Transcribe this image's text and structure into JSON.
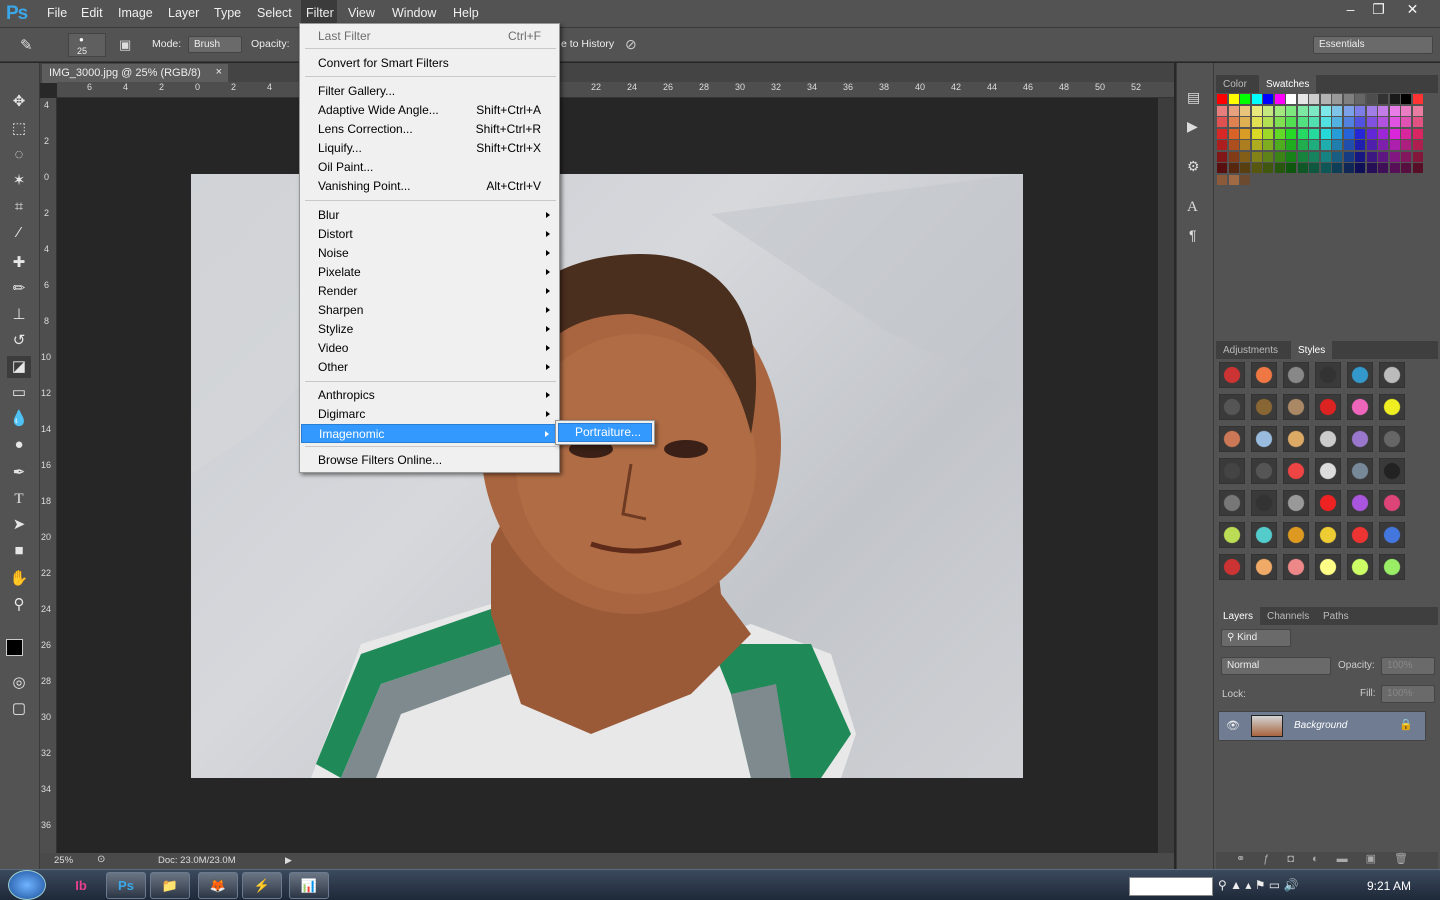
{
  "app": {
    "logo": "Ps",
    "workspace": "Essentials"
  },
  "menus": [
    "File",
    "Edit",
    "Image",
    "Layer",
    "Type",
    "Select",
    "Filter",
    "View",
    "Window",
    "Help"
  ],
  "window_controls": [
    "–",
    "❐",
    "✕"
  ],
  "options": {
    "brush_size": "25",
    "mode_label": "Mode:",
    "mode_value": "Brush",
    "opacity_label": "Opacity:",
    "history_label": "e to History"
  },
  "document": {
    "tab_title": "IMG_3000.jpg @ 25% (RGB/8)",
    "tab_close": "×",
    "zoom": "25%",
    "doc_size": "Doc: 23.0M/23.0M",
    "ruler_h": [
      "6",
      "4",
      "2",
      "0",
      "2",
      "4",
      "22",
      "24",
      "26",
      "28",
      "30",
      "32",
      "34",
      "36",
      "38",
      "40",
      "42",
      "44",
      "46",
      "48",
      "50",
      "52"
    ],
    "ruler_v": [
      "4",
      "2",
      "0",
      "2",
      "4",
      "6",
      "8",
      "10",
      "12",
      "14",
      "16",
      "18",
      "20",
      "22",
      "24",
      "26",
      "28",
      "30",
      "32",
      "34",
      "36"
    ]
  },
  "filter_menu": {
    "last_filter": {
      "label": "Last Filter",
      "shortcut": "Ctrl+F"
    },
    "convert_smart": "Convert for Smart Filters",
    "items_a": [
      {
        "label": "Filter Gallery...",
        "shortcut": ""
      },
      {
        "label": "Adaptive Wide Angle...",
        "shortcut": "Shift+Ctrl+A"
      },
      {
        "label": "Lens Correction...",
        "shortcut": "Shift+Ctrl+R"
      },
      {
        "label": "Liquify...",
        "shortcut": "Shift+Ctrl+X"
      },
      {
        "label": "Oil Paint...",
        "shortcut": ""
      },
      {
        "label": "Vanishing Point...",
        "shortcut": "Alt+Ctrl+V"
      }
    ],
    "submenus": [
      "Blur",
      "Distort",
      "Noise",
      "Pixelate",
      "Render",
      "Sharpen",
      "Stylize",
      "Video",
      "Other"
    ],
    "plugins": [
      "Anthropics",
      "Digimarc",
      "Imagenomic"
    ],
    "browse": "Browse Filters Online...",
    "highlighted": "Imagenomic",
    "imagenomic_submenu": [
      "Portraiture..."
    ]
  },
  "panels": {
    "color_tabs": [
      "Color",
      "Swatches"
    ],
    "adj_tabs": [
      "Adjustments",
      "Styles"
    ],
    "layer_tabs": [
      "Layers",
      "Channels",
      "Paths"
    ],
    "kind_label": "Kind",
    "blend_mode": "Normal",
    "opacity_label": "Opacity:",
    "opacity_value": "100%",
    "lock_label": "Lock:",
    "fill_label": "Fill:",
    "fill_value": "100%",
    "layer_name": "Background"
  },
  "taskbar": {
    "apps": [
      "Ib",
      "Ps",
      "📁",
      "🦊",
      "⚡",
      "📊"
    ],
    "clock": "9:21 AM"
  },
  "colors": {
    "accent": "#3399ff",
    "bg": "#535353",
    "canvas": "#262626"
  }
}
